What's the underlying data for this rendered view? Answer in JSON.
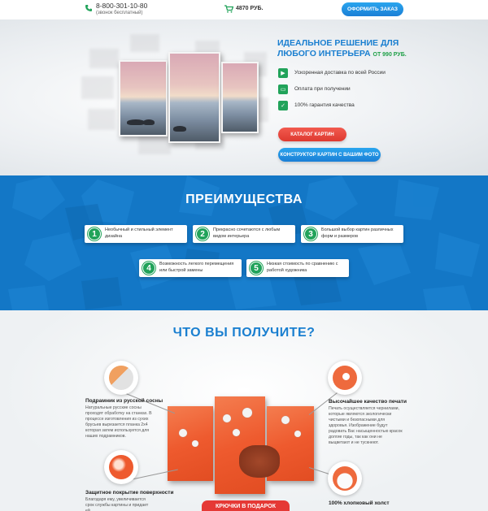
{
  "header": {
    "phone": "8-800-301-10-80",
    "phone_note": "(звонок бесплатный)",
    "cart_sum": "4870 РУБ.",
    "order_button": "ОФОРМИТЬ ЗАКАЗ"
  },
  "hero": {
    "title": "ИДЕАЛЬНОЕ РЕШЕНИЕ ДЛЯ ЛЮБОГО ИНТЕРЬЕРА",
    "price": "ОТ 990 РУБ.",
    "features": [
      {
        "icon": "truck-icon",
        "text": "Ускоренная доставка по всей России"
      },
      {
        "icon": "wallet-icon",
        "text": "Оплата при получении"
      },
      {
        "icon": "checklist-icon",
        "text": "100% гарантия качества"
      }
    ],
    "catalog_button": "КАТАЛОГ КАРТИН",
    "constructor_button": "КОНСТРУКТОР КАРТИН С ВАШИМ ФОТО"
  },
  "advantages": {
    "title": "ПРЕИМУЩЕСТВА",
    "items": [
      {
        "num": "1",
        "text": "Необычный и стильный элемент дизайна"
      },
      {
        "num": "2",
        "text": "Прекрасно сочетаются с любым видом интерьера"
      },
      {
        "num": "3",
        "text": "Большой выбор картин различных форм и размеров"
      },
      {
        "num": "4",
        "text": "Возможность легкого перемещения или быстрой замены"
      },
      {
        "num": "5",
        "text": "Низкая стоимость по сравнению с работой художника"
      }
    ]
  },
  "get": {
    "title": "ЧТО ВЫ ПОЛУЧИТЕ?",
    "frame_title": "Подрамник из русской сосны",
    "frame_text": "Натуральные русские сосны проходят обработку на станках. В процессе изготовления из сухих брусьев вырезается планка 2х4 которая затем используется для наших подрамников.",
    "print_title": "Высочайшее качество печати",
    "print_text": "Печать осуществляется чернилами, которые являются экологически чистыми и безопасными для здоровья. Изображение будут радовать Вас насыщенностью красок долгие годы, так как они не выцветают и не тускнеют.",
    "coating_title": "Защитное покрытие поверхности",
    "coating_text": "Благодаря ему, увеличивается срок службы картины и придает ей",
    "canvas_title": "100% хлопковый холст",
    "ribbon": "КРЮЧКИ В ПОДАРОК"
  },
  "colors": {
    "accent_blue": "#1a7fd0",
    "accent_green": "#21a35a",
    "accent_red": "#e53935",
    "section_blue": "#1377c6"
  }
}
